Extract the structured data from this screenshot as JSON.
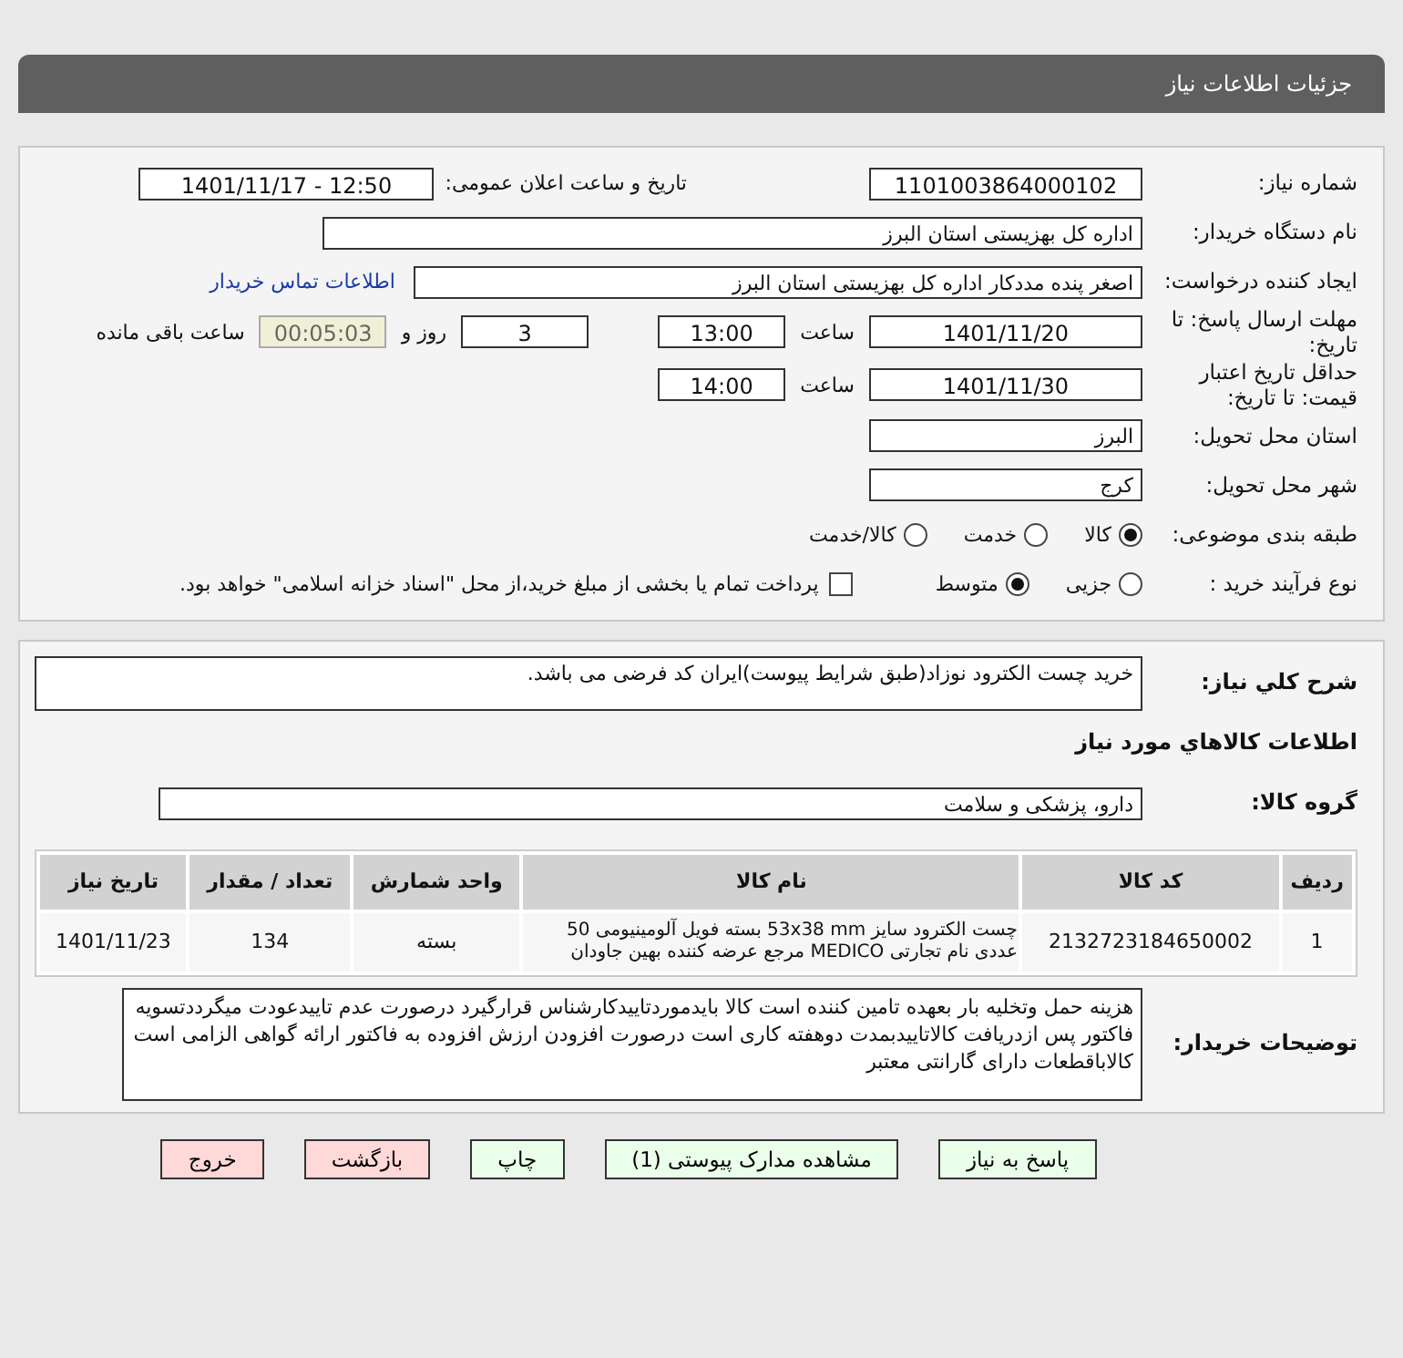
{
  "header": {
    "title": "جزئیات اطلاعات نیاز"
  },
  "details": {
    "need_number": {
      "label": "شماره نیاز:",
      "value": "1101003864000102"
    },
    "announce": {
      "label": "تاریخ و ساعت اعلان عمومی:",
      "value": "1401/11/17 - 12:50"
    },
    "buyer_org": {
      "label": "نام دستگاه خریدار:",
      "value": "اداره کل بهزیستی استان البرز"
    },
    "requester": {
      "label": "ایجاد کننده درخواست:",
      "value": "اصغر پنده مددکار اداره کل بهزیستی استان البرز"
    },
    "contact_link": "اطلاعات تماس خریدار",
    "response_deadline": {
      "label": "مهلت ارسال پاسخ: تا تاریخ:",
      "date": "1401/11/20",
      "time_label": "ساعت",
      "time": "13:00",
      "days": "3",
      "days_label": "روز و",
      "remaining": "00:05:03",
      "remaining_label": "ساعت باقی مانده"
    },
    "price_validity": {
      "label": "حداقل تاریخ اعتبار قیمت: تا تاریخ:",
      "date": "1401/11/30",
      "time_label": "ساعت",
      "time": "14:00"
    },
    "province": {
      "label": "استان محل تحویل:",
      "value": "البرز"
    },
    "city": {
      "label": "شهر محل تحویل:",
      "value": "کرج"
    },
    "category": {
      "label": "طبقه بندی موضوعی:",
      "options": [
        {
          "label": "کالا",
          "selected": true
        },
        {
          "label": "خدمت",
          "selected": false
        },
        {
          "label": "کالا/خدمت",
          "selected": false
        }
      ]
    },
    "process": {
      "label": "نوع فرآیند خرید :",
      "options": [
        {
          "label": "جزیی",
          "selected": false
        },
        {
          "label": "متوسط",
          "selected": true
        }
      ],
      "treasury": {
        "label": "پرداخت تمام یا بخشی از مبلغ خرید،از محل \"اسناد خزانه اسلامی\" خواهد بود.",
        "checked": false
      }
    }
  },
  "summary": {
    "label": "شرح کلي نياز:",
    "value": "خرید چست الکترود نوزاد(طبق شرایط پیوست)ایران کد فرضی می باشد."
  },
  "goods_title": "اطلاعات کالاهاي مورد نياز",
  "goods_group": {
    "label": "گروه کالا:",
    "value": "دارو، پزشکی و سلامت"
  },
  "table": {
    "columns": [
      "ردیف",
      "کد کالا",
      "نام کالا",
      "واحد شمارش",
      "تعداد / مقدار",
      "تاریخ نیاز"
    ],
    "rows": [
      [
        "1",
        "2132723184650002",
        "چست الکترود سایز 53x38 mm بسته فویل آلومینیومی 50 عددی نام تجارتی MEDICO مرجع عرضه کننده بهین جاودان",
        "بسته",
        "134",
        "1401/11/23"
      ]
    ]
  },
  "buyer_notes": {
    "label": "توضیحات خریدار:",
    "value": "هزینه حمل وتخلیه بار بعهده تامین کننده است کالا بایدموردتاییدکارشناس قرارگیرد درصورت عدم تاییدعودت میگرددتسویه فاکتور پس ازدریافت کالاتاییدبمدت دوهفته کاری است درصورت افزودن ارزش افزوده به فاکتور ارائه گواهی الزامی است کالاباقطعات دارای گارانتی معتبر"
  },
  "buttons": [
    {
      "label": "پاسخ به نیاز",
      "kind": "normal"
    },
    {
      "label": "مشاهده مدارک پیوستی (1)",
      "kind": "normal"
    },
    {
      "label": "چاپ",
      "kind": "normal"
    },
    {
      "label": "بازگشت",
      "kind": "exit"
    },
    {
      "label": "خروج",
      "kind": "exit"
    }
  ]
}
